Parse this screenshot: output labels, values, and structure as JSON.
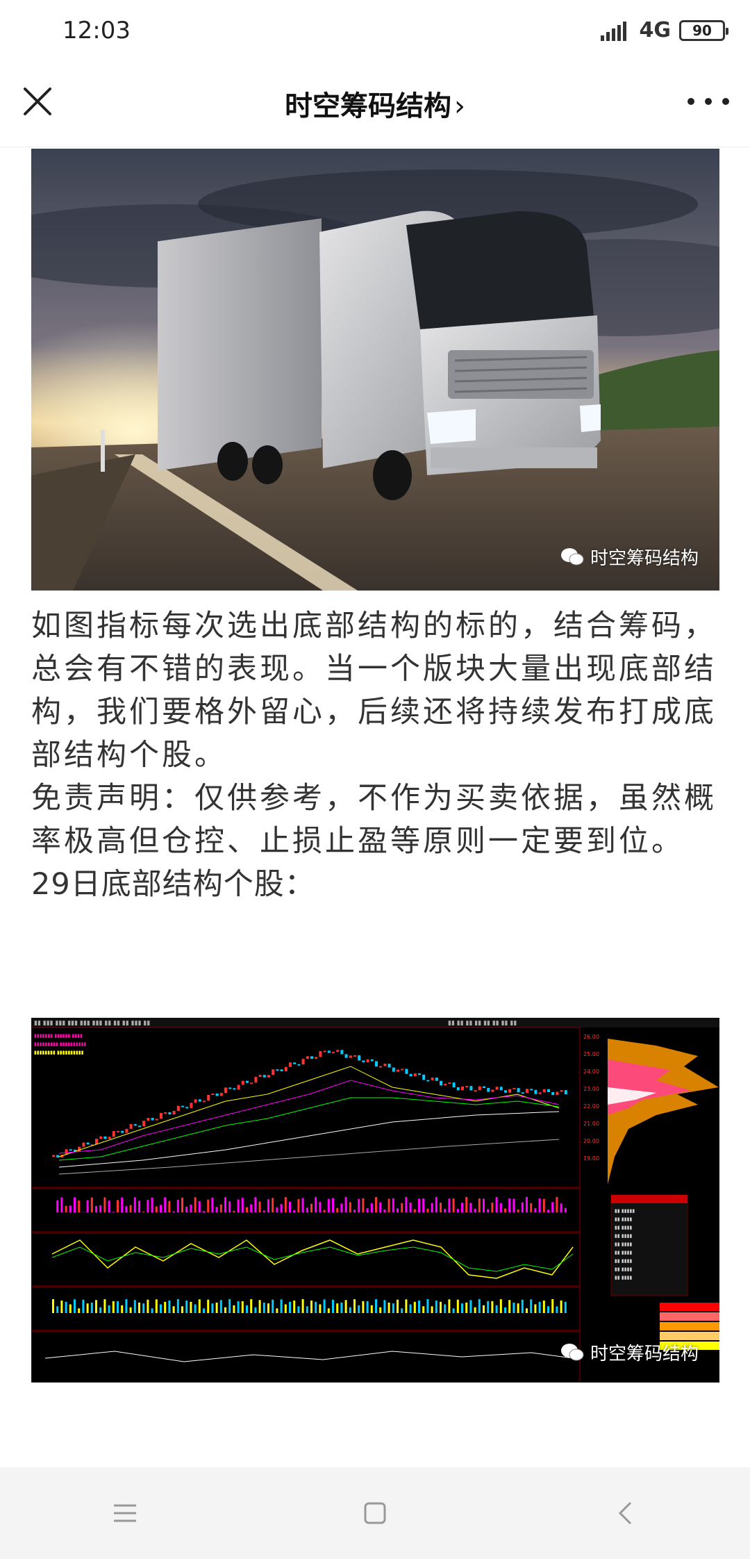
{
  "status_bar": {
    "time": "12:03",
    "network": "4G",
    "battery": "90"
  },
  "header": {
    "title": "时空筹码结构",
    "title_suffix": "›",
    "close_icon": "close-icon",
    "more_icon": "more-icon"
  },
  "hero_image": {
    "description_icon": "truck-photo",
    "watermark": "时空筹码结构"
  },
  "article": {
    "paragraphs": [
      "如图指标每次选出底部结构的标的，结合筹码，总会有不错的表现。当一个版块大量出现底部结构，我们要格外留心，后续还将持续发布打成底部结构个股。",
      "免责声明：仅供参考，不作为买卖依据，虽然概率极高但仓控、止损止盈等原则一定要到位。",
      "29日底部结构个股："
    ]
  },
  "stock_chart": {
    "watermark": "时空筹码结构"
  },
  "colors": {
    "background": "#ffffff",
    "text": "#333333",
    "chart_bg": "#000000",
    "nav_bg": "#f4f4f4"
  }
}
